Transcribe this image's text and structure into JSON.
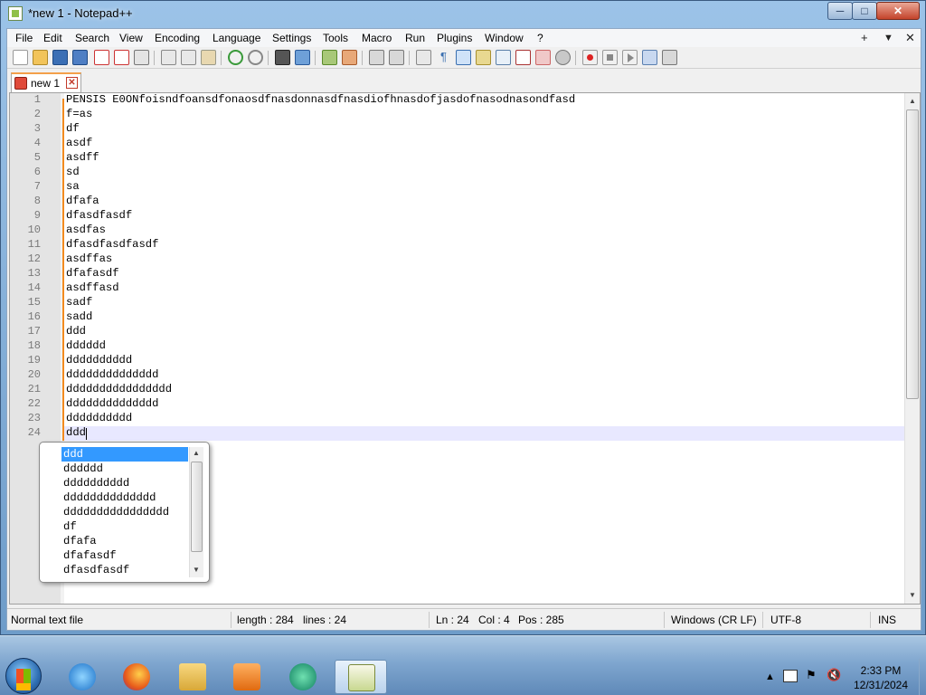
{
  "window": {
    "title": "*new 1 - Notepad++",
    "controls": {
      "minimize": "─",
      "maximize": "□",
      "close": "✕"
    }
  },
  "menu": {
    "items": [
      "File",
      "Edit",
      "Search",
      "View",
      "Encoding",
      "Language",
      "Settings",
      "Tools",
      "Macro",
      "Run",
      "Plugins",
      "Window",
      "?"
    ],
    "right": {
      "plus": "+",
      "down": "▼",
      "close": "✕"
    }
  },
  "tabs": [
    {
      "label": "new 1",
      "modified": true
    }
  ],
  "editor": {
    "lines": [
      "PENSIS E0ONfoisndfoansdfonaosdfnasdonnasdfnasdiofhnasdofjasdofnasodnasondfasd",
      "f=as",
      "df",
      "asdf",
      "asdff",
      "sd",
      "sa",
      "dfafa",
      "dfasdfasdf",
      "asdfas",
      "dfasdfasdfasdf",
      "asdffas",
      "dfafasdf",
      "asdffasd",
      "sadf",
      "sadd",
      "ddd",
      "dddddd",
      "dddddddddd",
      "dddddddddddddd",
      "dddddddddddddddd",
      "dddddddddddddd",
      "dddddddddd",
      "ddd"
    ],
    "current_line": 24
  },
  "autocomplete": {
    "items": [
      "ddd",
      "dddddd",
      "dddddddddd",
      "dddddddddddddd",
      "dddddddddddddddd",
      "df",
      "dfafa",
      "dfafasdf",
      "dfasdfasdf"
    ],
    "selected_index": 0
  },
  "statusbar": {
    "filetype": "Normal text file",
    "length": "length : 284",
    "lines": "lines : 24",
    "ln": "Ln : 24",
    "col": "Col : 4",
    "pos": "Pos : 285",
    "eol": "Windows (CR LF)",
    "encoding": "UTF-8",
    "mode": "INS"
  },
  "taskbar": {
    "apps": [
      "internet-explorer",
      "firefox",
      "file-explorer",
      "media-player",
      "app-5",
      "notepad-plus-plus"
    ],
    "active_app": "notepad-plus-plus",
    "clock_time": "2:33 PM",
    "clock_date": "12/31/2024"
  },
  "colors": {
    "selection": "#3399ff",
    "current_line": "#e8e8ff",
    "change_bar": "#f28b20",
    "tab_accent": "#f3a04a"
  }
}
